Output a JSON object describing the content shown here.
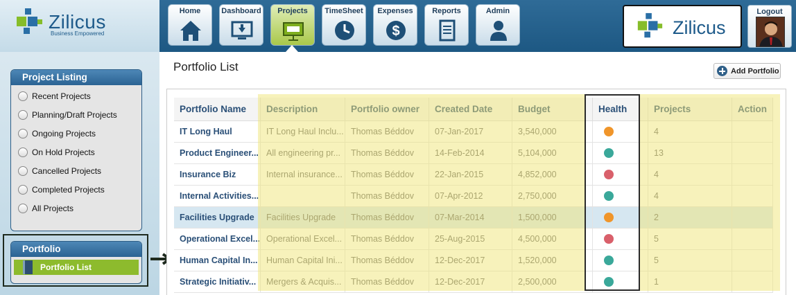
{
  "brand": {
    "name": "Zilicus",
    "tagline": "Business Empowered"
  },
  "nav": {
    "tabs": [
      {
        "label": "Home",
        "icon": "home-icon"
      },
      {
        "label": "Dashboard",
        "icon": "monitor-icon"
      },
      {
        "label": "Projects",
        "icon": "presentation-icon",
        "active": true
      },
      {
        "label": "TimeSheet",
        "icon": "clock-icon"
      },
      {
        "label": "Expenses",
        "icon": "dollar-icon"
      },
      {
        "label": "Reports",
        "icon": "document-icon"
      },
      {
        "label": "Admin",
        "icon": "user-icon"
      }
    ],
    "logout_label": "Logout"
  },
  "sidebar": {
    "project_listing": {
      "title": "Project Listing",
      "items": [
        "Recent Projects",
        "Planning/Draft Projects",
        "Ongoing Projects",
        "On Hold Projects",
        "Cancelled Projects",
        "Completed Projects",
        "All Projects"
      ]
    },
    "portfolio": {
      "title": "Portfolio",
      "item": "Portfolio List"
    }
  },
  "main": {
    "title": "Portfolio List",
    "add_button": "Add Portfolio",
    "columns": [
      "Portfolio Name",
      "Description",
      "Portfolio owner",
      "Created Date",
      "Budget",
      "Health",
      "Projects",
      "Action"
    ],
    "rows": [
      {
        "name": "IT Long Haul",
        "description": "IT Long Haul Inclu...",
        "owner": "Thomas Béddov",
        "created": "07-Jan-2017",
        "budget": "3,540,000",
        "health": "orange",
        "projects": "4"
      },
      {
        "name": "Product Engineer...",
        "description": "All engineering pr...",
        "owner": "Thomas Béddov",
        "created": "14-Feb-2014",
        "budget": "5,104,000",
        "health": "teal",
        "projects": "13"
      },
      {
        "name": "Insurance Biz",
        "description": "Internal insurance...",
        "owner": "Thomas Béddov",
        "created": "22-Jan-2015",
        "budget": "4,852,000",
        "health": "red",
        "projects": "4"
      },
      {
        "name": "Internal Activities...",
        "description": "",
        "owner": "Thomas Béddov",
        "created": "07-Apr-2012",
        "budget": "2,750,000",
        "health": "teal",
        "projects": "4"
      },
      {
        "name": "Facilities Upgrade",
        "description": "Facilities Upgrade",
        "owner": "Thomas Béddov",
        "created": "07-Mar-2014",
        "budget": "1,500,000",
        "health": "orange",
        "projects": "2",
        "selected": true
      },
      {
        "name": "Operational Excel...",
        "description": "Operational Excel...",
        "owner": "Thomas Béddov",
        "created": "25-Aug-2015",
        "budget": "4,500,000",
        "health": "red",
        "projects": "5"
      },
      {
        "name": "Human Capital In...",
        "description": "Human Capital Ini...",
        "owner": "Thomas Béddov",
        "created": "12-Dec-2017",
        "budget": "1,520,000",
        "health": "teal",
        "projects": "5"
      },
      {
        "name": "Strategic Initiativ...",
        "description": "Mergers & Acquis...",
        "owner": "Thomas Béddov",
        "created": "12-Dec-2017",
        "budget": "2,500,000",
        "health": "teal",
        "projects": "1"
      }
    ]
  },
  "colors": {
    "orange": "#f0952a",
    "teal": "#3aa89a",
    "red": "#d9606b",
    "accent": "#8dbb2d",
    "header": "#1d5883"
  }
}
